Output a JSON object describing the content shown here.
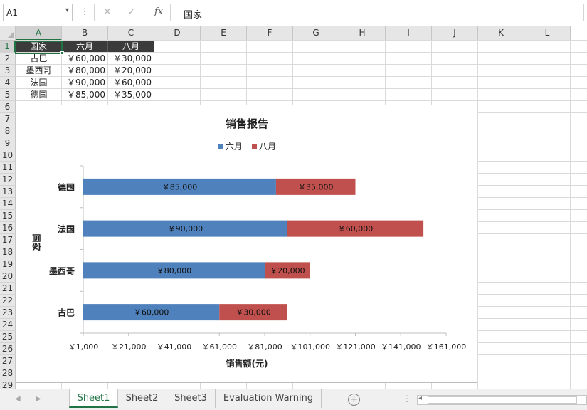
{
  "formula_bar": {
    "name_box": "A1",
    "formula": "国家"
  },
  "icons": {
    "name_box_dropdown": "chevron-down-icon",
    "cancel": "close-icon",
    "enter": "checkmark-icon",
    "fx": "function-icon",
    "add_sheet": "plus-circle-icon"
  },
  "columns": [
    "A",
    "B",
    "C",
    "D",
    "E",
    "F",
    "G",
    "H",
    "I",
    "J",
    "K",
    "L"
  ],
  "rows": [
    "1",
    "2",
    "3",
    "4",
    "5",
    "6",
    "7",
    "8",
    "9",
    "10",
    "11",
    "12",
    "13",
    "14",
    "15",
    "16",
    "17",
    "18",
    "19",
    "20",
    "21",
    "22",
    "23",
    "24",
    "25",
    "26",
    "27",
    "28",
    "29"
  ],
  "table": {
    "headers": [
      "国家",
      "六月",
      "八月"
    ],
    "rows": [
      [
        "古巴",
        "￥60,000",
        "￥30,000"
      ],
      [
        "墨西哥",
        "￥80,000",
        "￥20,000"
      ],
      [
        "法国",
        "￥90,000",
        "￥60,000"
      ],
      [
        "德国",
        "￥85,000",
        "￥35,000"
      ]
    ]
  },
  "chart_data": {
    "type": "bar",
    "orientation": "horizontal",
    "stacked": true,
    "title": "销售报告",
    "xlabel": "销售额(元)",
    "ylabel": "国家",
    "categories": [
      "古巴",
      "墨西哥",
      "法国",
      "德国"
    ],
    "series": [
      {
        "name": "六月",
        "values": [
          60000,
          80000,
          90000,
          85000
        ],
        "labels": [
          "￥60,000",
          "￥80,000",
          "￥90,000",
          "￥85,000"
        ],
        "color": "#4f81bd"
      },
      {
        "name": "八月",
        "values": [
          30000,
          20000,
          60000,
          35000
        ],
        "labels": [
          "￥30,000",
          "￥20,000",
          "￥60,000",
          "￥35,000"
        ],
        "color": "#c0504d"
      }
    ],
    "xlim": [
      1000,
      161000
    ],
    "xticks": [
      1000,
      21000,
      41000,
      61000,
      81000,
      101000,
      121000,
      141000,
      161000
    ],
    "xtick_labels": [
      "￥1,000",
      "￥21,000",
      "￥41,000",
      "￥61,000",
      "￥81,000",
      "￥101,000",
      "￥121,000",
      "￥141,000",
      "￥161,000"
    ],
    "legend": "top",
    "grid": false
  },
  "sheet_tabs": [
    "Sheet1",
    "Sheet2",
    "Sheet3",
    "Evaluation Warning"
  ],
  "active_tab": "Sheet1",
  "nav": {
    "prev": "◀",
    "next": "▶",
    "dots": "⋮",
    "add": "+"
  }
}
